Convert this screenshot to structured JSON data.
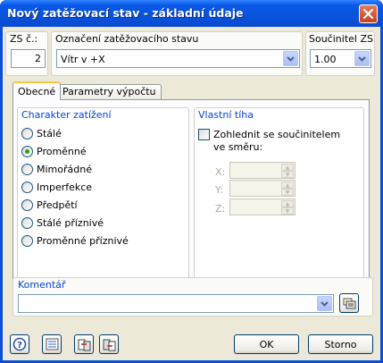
{
  "window": {
    "title": "Nový zatěžovací stav - základní údaje"
  },
  "header": {
    "zs_label": "ZS č.:",
    "zs_value": "2",
    "designation_label": "Označení zatěžovacího stavu",
    "designation_value": "Vítr v +X",
    "factor_label": "Součinitel ZS",
    "factor_value": "1.00"
  },
  "tabs": [
    {
      "label": "Obecné",
      "active": true
    },
    {
      "label": "Parametry výpočtu",
      "active": false
    }
  ],
  "load_character": {
    "title": "Charakter zatížení",
    "options": [
      {
        "label": "Stálé",
        "selected": false
      },
      {
        "label": "Proměnné",
        "selected": true
      },
      {
        "label": "Mimořádné",
        "selected": false
      },
      {
        "label": "Imperfekce",
        "selected": false
      },
      {
        "label": "Předpětí",
        "selected": false
      },
      {
        "label": "Stálé příznivé",
        "selected": false
      },
      {
        "label": "Proměnné příznivé",
        "selected": false
      }
    ]
  },
  "self_weight": {
    "title": "Vlastní tíha",
    "checkbox_label_line1": "Zohlednit se součinitelem",
    "checkbox_label_line2": "ve směru:",
    "checked": false,
    "x_label": "X:",
    "y_label": "Y:",
    "z_label": "Z:"
  },
  "comment": {
    "title": "Komentář",
    "value": ""
  },
  "buttons": {
    "ok": "OK",
    "cancel": "Storno"
  },
  "colors": {
    "title_bar": "#0753dc",
    "group_title": "#0046d5",
    "selected_radio": "#21a121"
  }
}
